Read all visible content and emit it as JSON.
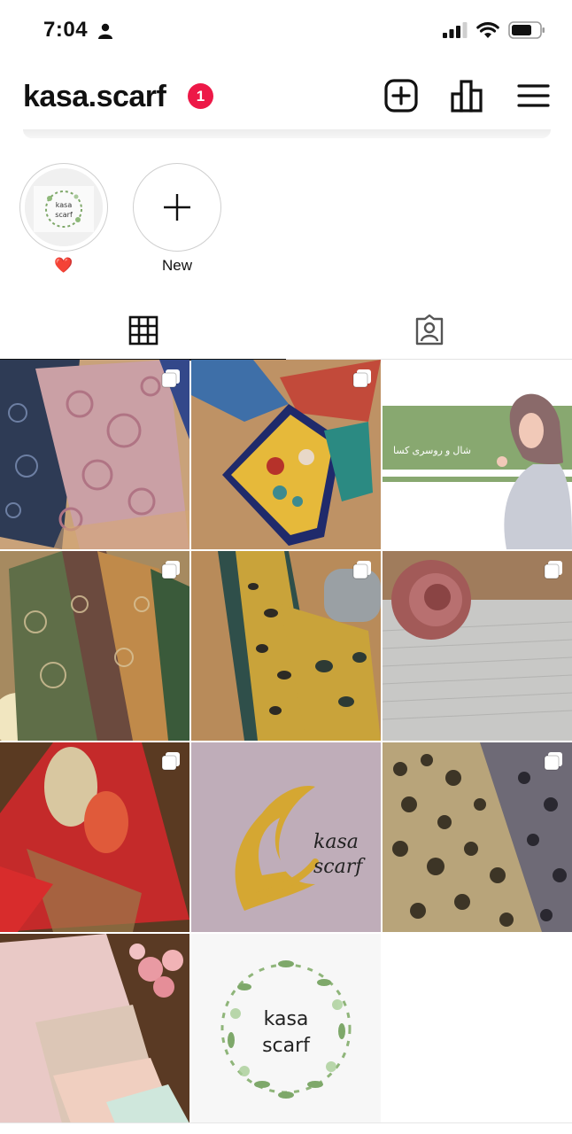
{
  "status_bar": {
    "time": "7:04"
  },
  "header": {
    "username": "kasa.scarf",
    "notification_count": "1"
  },
  "highlights": [
    {
      "label": "❤️",
      "thumb_text": [
        "kasa",
        "scarf"
      ]
    },
    {
      "label": "New"
    }
  ],
  "tabs": [
    "grid",
    "tagged"
  ],
  "posts": [
    {
      "multi": true
    },
    {
      "multi": true
    },
    {
      "multi": false,
      "text": "شال و روسری کسا"
    },
    {
      "multi": true
    },
    {
      "multi": true
    },
    {
      "multi": true
    },
    {
      "multi": true
    },
    {
      "multi": false,
      "text": [
        "kasa",
        "scarf"
      ]
    },
    {
      "multi": true
    },
    {
      "multi": false
    },
    {
      "multi": false,
      "text": [
        "kasa",
        "scarf"
      ]
    }
  ],
  "colors": {
    "badge": "#ed1847",
    "logo_gold": "#d5a732",
    "logo_bg": "#bfadb9",
    "banner_green": "#88a870"
  }
}
